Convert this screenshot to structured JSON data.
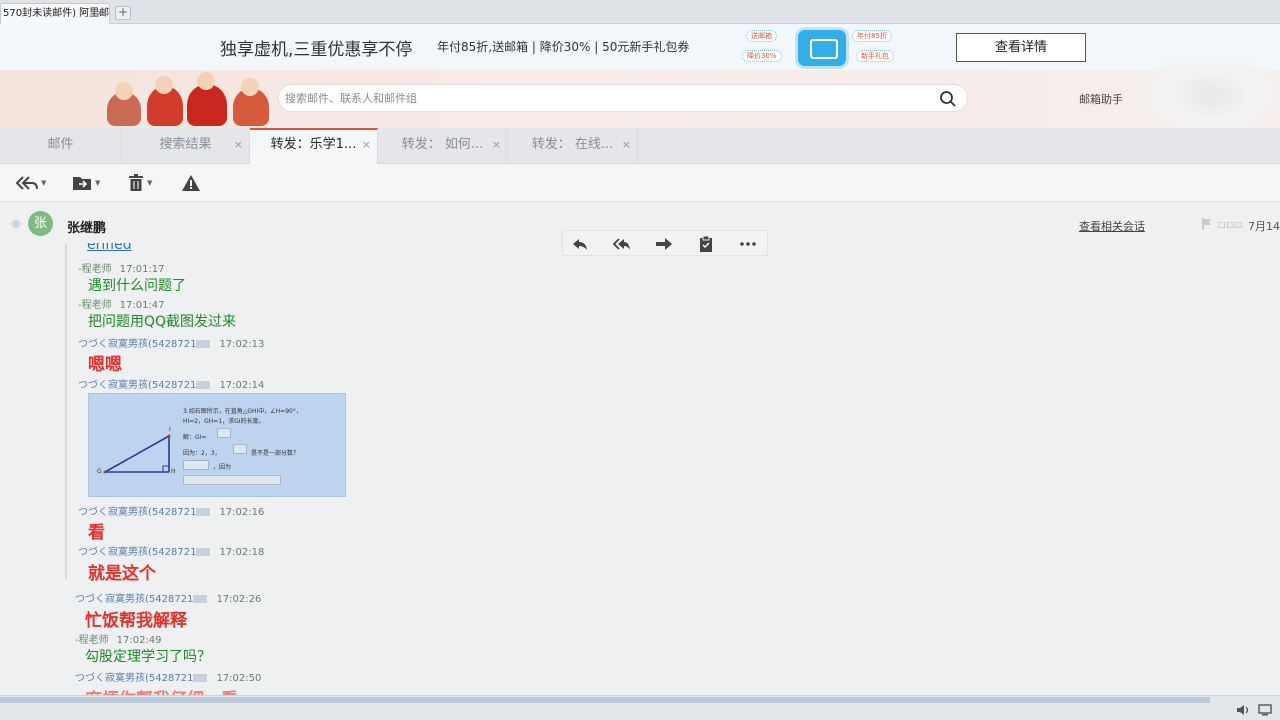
{
  "browser": {
    "tab_title": "570封未读邮件) 阿里邮",
    "close_glyph": "×",
    "newtab_glyph": "+"
  },
  "ad": {
    "title": "独享虚机,三重优惠享不停",
    "subtitle": "年付85折,送邮箱 | 降价30% | 50元新手礼包券",
    "bubbles": [
      "送邮箱",
      "降价30%",
      "年付85折",
      "新手礼包"
    ],
    "button": "查看详情"
  },
  "header": {
    "search_placeholder": "搜索邮件、联系人和邮件组",
    "assistant": "邮箱助手"
  },
  "tabs": [
    {
      "label": "邮件",
      "closable": false,
      "active": false
    },
    {
      "label": "搜索结果",
      "closable": true,
      "active": false
    },
    {
      "label": "转发：乐学1...",
      "closable": true,
      "active": true
    },
    {
      "label": "转发： 如何...",
      "closable": true,
      "active": false
    },
    {
      "label": "转发： 在线...",
      "closable": true,
      "active": false
    }
  ],
  "toolbar": {
    "icons": [
      "reply-all-icon",
      "move-icon",
      "delete-icon",
      "report-icon"
    ]
  },
  "mail": {
    "avatar_char": "张",
    "sender": "张继鹏",
    "related_link": "查看相关会话",
    "date": "7月14",
    "dots": "□□□"
  },
  "content": {
    "verified": "erified",
    "messages": [
      {
        "author": "-程老师",
        "time": "17:01:17",
        "text": "遇到什么问题了",
        "style": "green"
      },
      {
        "author": "-程老师",
        "time": "17:01:47",
        "text": "把问题用QQ截图发过来",
        "style": "green"
      },
      {
        "author": "つづく寂寞男孩(5428721",
        "time": "17:02:13",
        "text": "嗯嗯",
        "style": "red"
      },
      {
        "author": "つづく寂寞男孩(5428721",
        "time": "17:02:14",
        "text": "",
        "style": "image"
      },
      {
        "author": "つづく寂寞男孩(5428721",
        "time": "17:02:16",
        "text": "看",
        "style": "red"
      },
      {
        "author": "つづく寂寞男孩(5428721",
        "time": "17:02:18",
        "text": "就是这个",
        "style": "red"
      },
      {
        "author": "つづく寂寞男孩(5428721",
        "time": "17:02:26",
        "text": "忙饭帮我解释",
        "style": "red"
      },
      {
        "author": "-程老师",
        "time": "17:02:49",
        "text": "勾股定理学习了吗？",
        "style": "green"
      },
      {
        "author": "つづく寂寞男孩(5428721",
        "time": "17:02:50",
        "text": "麻烦你帮我仔细一看",
        "style": "red-faded"
      }
    ],
    "screenshot": {
      "line1": "3.如右图所示，在直角△GHI中，∠H=90°，",
      "line2": "HI=2，GH=1，求GI的长度。",
      "line3": "解：GI=",
      "line4": "因为：2，3，",
      "line5": "是不是一部分数？",
      "line6": "，因为",
      "vertex_g": "G",
      "vertex_h": "H",
      "vertex_i": "I"
    }
  },
  "colors": {
    "accent_red": "#e0523f",
    "green_text": "#1f8a26",
    "red_text": "#e3322b",
    "link_blue": "#2d6fcf"
  }
}
